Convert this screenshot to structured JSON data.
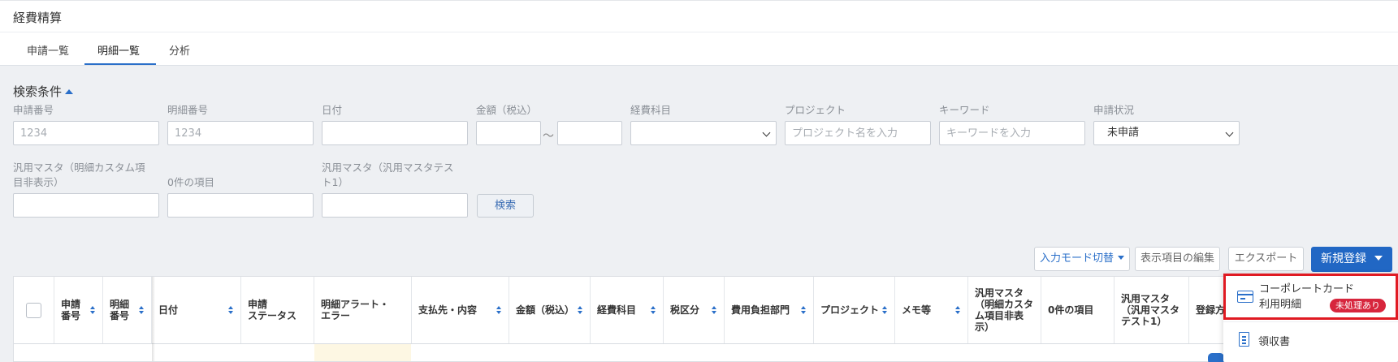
{
  "app": {
    "title": "経費精算"
  },
  "tabs": [
    {
      "label": "申請一覧",
      "active": false
    },
    {
      "label": "明細一覧",
      "active": true
    },
    {
      "label": "分析",
      "active": false
    }
  ],
  "search": {
    "heading": "検索条件",
    "fields": {
      "application_number": {
        "label": "申請番号",
        "placeholder": "1234"
      },
      "detail_number": {
        "label": "明細番号",
        "placeholder": "1234"
      },
      "date": {
        "label": "日付",
        "value": ""
      },
      "amount": {
        "label": "金額（税込）",
        "range_separator": "～"
      },
      "expense_item": {
        "label": "経費科目",
        "value": ""
      },
      "project": {
        "label": "プロジェクト",
        "placeholder": "プロジェクト名を入力"
      },
      "keyword": {
        "label": "キーワード",
        "placeholder": "キーワードを入力"
      },
      "application_status": {
        "label": "申請状況",
        "value": "未申請"
      },
      "generic_master_hidden": {
        "label_line1": "汎用マスタ（明細カスタム項",
        "label_line2": "目非表示）"
      },
      "zero_items": {
        "label": "0件の項目"
      },
      "generic_master_test": {
        "label_line1": "汎用マスタ（汎用マスタテス",
        "label_line2": "ト1）"
      }
    },
    "search_button": "検索"
  },
  "toolbar": {
    "input_mode": "入力モード切替",
    "edit_columns": "表示項目の編集",
    "export": "エクスポート",
    "new": "新規登録"
  },
  "table": {
    "columns": [
      {
        "line1": "申請",
        "line2": "番号",
        "sortable": true
      },
      {
        "line1": "明細",
        "line2": "番号",
        "sortable": true
      },
      {
        "line1": "日付",
        "sortable": true
      },
      {
        "line1": "申請",
        "line2": "ステータス",
        "sortable": false
      },
      {
        "line1": "明細アラート・",
        "line2": "エラー",
        "sortable": false
      },
      {
        "line1": "支払先・内容",
        "sortable": true
      },
      {
        "line1": "金額（税込）",
        "sortable": true
      },
      {
        "line1": "経費科目",
        "sortable": true
      },
      {
        "line1": "税区分",
        "sortable": true
      },
      {
        "line1": "費用負担部門",
        "sortable": true
      },
      {
        "line1": "プロジェクト",
        "sortable": true
      },
      {
        "line1": "メモ等",
        "sortable": true
      },
      {
        "line1": "汎用マスタ",
        "line2": "（明細カスタ",
        "line3": "ム項目非表",
        "line4": "示）",
        "sortable": false
      },
      {
        "line1": "0件の項目",
        "sortable": false
      },
      {
        "line1": "汎用マスタ",
        "line2": "（汎用マスタ",
        "line3": "テスト1）",
        "sortable": false
      },
      {
        "line1": "登録方",
        "sortable": false
      }
    ]
  },
  "new_menu": {
    "corporate_card_line1": "コーポレートカード",
    "corporate_card_line2": "利用明細",
    "corporate_card_badge": "未処理あり",
    "receipt": "領収書"
  },
  "colors": {
    "accent": "#2167c4",
    "badge": "#d7263d",
    "highlight_border": "#e01a22"
  }
}
